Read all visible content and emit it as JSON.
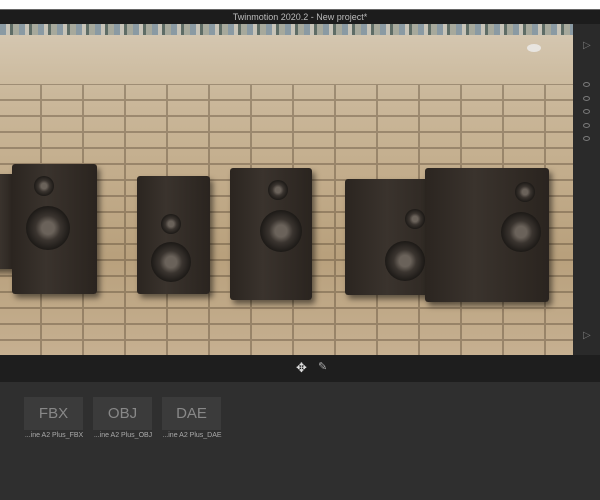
{
  "window": {
    "title": "Twinmotion 2020.2 - New project*"
  },
  "toolbar": {
    "move_icon": "✥",
    "eyedropper_icon": "✎"
  },
  "library": {
    "items": [
      {
        "format": "FBX",
        "label": "...ine A2 Plus_FBX"
      },
      {
        "format": "OBJ",
        "label": "...ine A2 Plus_OBJ"
      },
      {
        "format": "DAE",
        "label": "...ine A2 Plus_DAE"
      }
    ]
  },
  "right_panel": {
    "expand_icon": "▷"
  }
}
